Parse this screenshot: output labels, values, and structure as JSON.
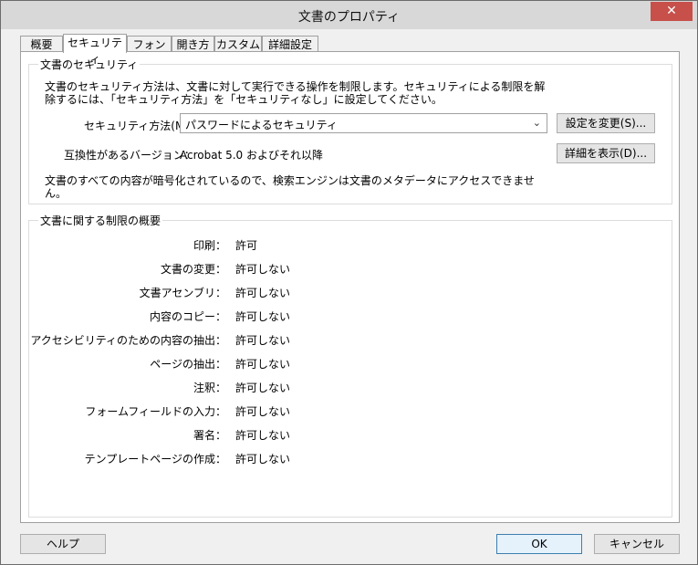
{
  "window": {
    "title": "文書のプロパティ"
  },
  "tabs": [
    "概要",
    "セキュリティ",
    "フォント",
    "開き方",
    "カスタム",
    "詳細設定"
  ],
  "security_group": {
    "label": "文書のセキュリティ",
    "desc_line1": "文書のセキュリティ方法は、文書に対して実行できる操作を制限します。セキュリティによる制限を解",
    "desc_line2": "除するには、「セキュリティ方法」を「セキュリティなし」に設定してください。",
    "method_label": "セキュリティ方法(M)：",
    "method_value": "パスワードによるセキュリティ",
    "change_button": "設定を変更(S)...",
    "compat_label": "互換性があるバージョン：",
    "compat_value": "Acrobat 5.0 およびそれ以降",
    "details_button": "詳細を表示(D)...",
    "encrypt_line1": "文書のすべての内容が暗号化されているので、検索エンジンは文書のメタデータにアクセスできませ",
    "encrypt_line2": "ん。"
  },
  "restrictions_group": {
    "label": "文書に関する制限の概要",
    "rows": [
      {
        "label": "印刷：",
        "value": "許可"
      },
      {
        "label": "文書の変更：",
        "value": "許可しない"
      },
      {
        "label": "文書アセンブリ：",
        "value": "許可しない"
      },
      {
        "label": "内容のコピー：",
        "value": "許可しない"
      },
      {
        "label": "アクセシビリティのための内容の抽出：",
        "value": "許可しない"
      },
      {
        "label": "ページの抽出：",
        "value": "許可しない"
      },
      {
        "label": "注釈：",
        "value": "許可しない"
      },
      {
        "label": "フォームフィールドの入力：",
        "value": "許可しない"
      },
      {
        "label": "署名：",
        "value": "許可しない"
      },
      {
        "label": "テンプレートページの作成：",
        "value": "許可しない"
      }
    ]
  },
  "footer": {
    "help": "ヘルプ",
    "ok": "OK",
    "cancel": "キャンセル"
  },
  "icons": {
    "close": "close-icon",
    "dropdown": "chevron-down-icon"
  }
}
